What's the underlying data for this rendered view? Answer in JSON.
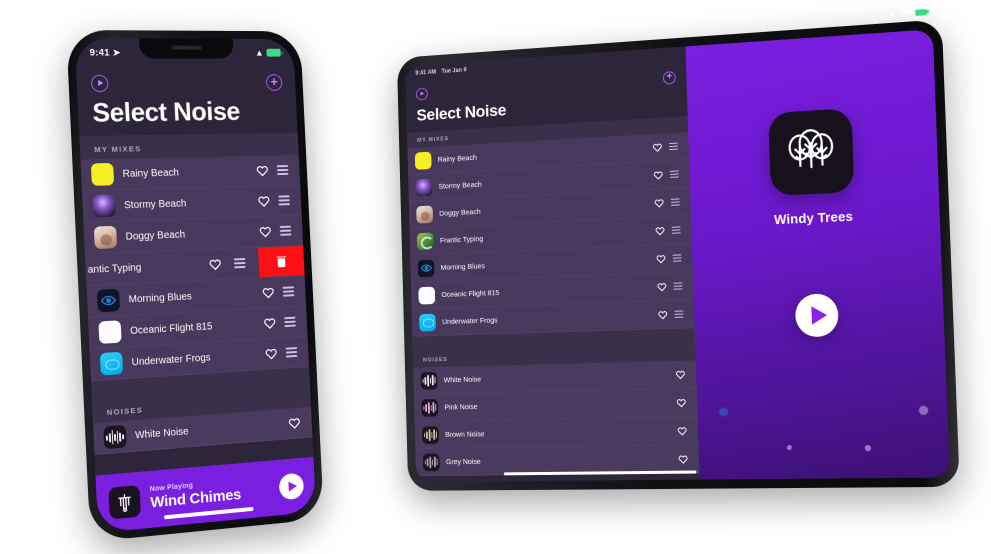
{
  "app": {
    "title": "Select Noise",
    "accent": "#8a22e8",
    "list_bg": "#48395c",
    "screen_bg": "#2d2539",
    "delete_color": "#fd1014"
  },
  "phone": {
    "status": {
      "time": "9:41",
      "location_icon": "location-arrow-icon",
      "wifi_icon": "wifi-icon",
      "battery_icon": "battery-icon"
    },
    "topbar": {
      "left_icon": "play-circle-icon",
      "right_icon": "add-circle-icon"
    },
    "title": "Select Noise",
    "sections": [
      {
        "header": "MY MIXES",
        "rows": [
          {
            "label": "Rainy Beach",
            "thumb": "solid-yellow",
            "favorite_icon": "heart-outline-icon",
            "drag_icon": "drag-handle-icon",
            "swiped": false
          },
          {
            "label": "Stormy Beach",
            "thumb": "storm-art",
            "favorite_icon": "heart-outline-icon",
            "drag_icon": "drag-handle-icon",
            "swiped": false
          },
          {
            "label": "Doggy Beach",
            "thumb": "dog-photo",
            "favorite_icon": "heart-outline-icon",
            "drag_icon": "drag-handle-icon",
            "swiped": false
          },
          {
            "label": "antic Typing",
            "thumb": "hidden",
            "favorite_icon": "heart-outline-icon",
            "drag_icon": "drag-handle-icon",
            "swiped": true,
            "delete_label": "trash-icon"
          },
          {
            "label": "Morning Blues",
            "thumb": "eye-dark-blue",
            "favorite_icon": "heart-outline-icon",
            "drag_icon": "drag-handle-icon",
            "swiped": false
          },
          {
            "label": "Oceanic Flight 815",
            "thumb": "solid-white",
            "favorite_icon": "heart-outline-icon",
            "drag_icon": "drag-handle-icon",
            "swiped": false
          },
          {
            "label": "Underwater Frogs",
            "thumb": "solid-cyan",
            "favorite_icon": "heart-outline-icon",
            "drag_icon": "drag-handle-icon",
            "swiped": false
          }
        ]
      },
      {
        "header": "NOISES",
        "rows": [
          {
            "label": "White Noise",
            "thumb": "waveform-white",
            "favorite_icon": "heart-outline-icon",
            "drag_icon": null,
            "swiped": false
          }
        ]
      }
    ],
    "now_playing": {
      "kicker": "Now Playing",
      "title": "Wind Chimes",
      "icon": "wind-chimes-icon",
      "play_icon": "play-icon"
    }
  },
  "tablet": {
    "status": {
      "time": "9:41 AM",
      "date": "Tue Jan 9",
      "wifi_icon": "wifi-icon",
      "battery_percent": "38%",
      "battery_icon": "battery-icon"
    },
    "topbar": {
      "left_icon": "play-circle-icon",
      "right_icon": "add-circle-icon"
    },
    "title": "Select Noise",
    "sections": [
      {
        "header": "MY MIXES",
        "rows": [
          {
            "label": "Rainy Beach",
            "thumb": "solid-yellow",
            "favorite_icon": "heart-outline-icon",
            "drag_icon": "drag-handle-icon"
          },
          {
            "label": "Stormy Beach",
            "thumb": "storm-art",
            "favorite_icon": "heart-outline-icon",
            "drag_icon": "drag-handle-icon"
          },
          {
            "label": "Doggy Beach",
            "thumb": "dog-photo",
            "favorite_icon": "heart-outline-icon",
            "drag_icon": "drag-handle-icon"
          },
          {
            "label": "Frantic Typing",
            "thumb": "green-keyboard",
            "favorite_icon": "heart-outline-icon",
            "drag_icon": "drag-handle-icon"
          },
          {
            "label": "Morning Blues",
            "thumb": "eye-dark-blue",
            "favorite_icon": "heart-outline-icon",
            "drag_icon": "drag-handle-icon"
          },
          {
            "label": "Oceanic Flight 815",
            "thumb": "solid-white",
            "favorite_icon": "heart-outline-icon",
            "drag_icon": "drag-handle-icon"
          },
          {
            "label": "Underwater Frogs",
            "thumb": "solid-cyan",
            "favorite_icon": "heart-outline-icon",
            "drag_icon": "drag-handle-icon"
          }
        ]
      },
      {
        "header": "NOISES",
        "rows": [
          {
            "label": "White Noise",
            "thumb": "waveform-white",
            "favorite_icon": "heart-outline-icon",
            "drag_icon": null
          },
          {
            "label": "Pink Noise",
            "thumb": "waveform-pink",
            "favorite_icon": "heart-outline-icon",
            "drag_icon": null
          },
          {
            "label": "Brown Noise",
            "thumb": "waveform-brown",
            "favorite_icon": "heart-outline-icon",
            "drag_icon": null
          },
          {
            "label": "Grey Noise",
            "thumb": "waveform-grey",
            "favorite_icon": "heart-outline-icon",
            "drag_icon": null
          }
        ]
      }
    ],
    "detail": {
      "icon": "trees-icon",
      "name": "Windy Trees",
      "play_icon": "play-icon"
    }
  }
}
